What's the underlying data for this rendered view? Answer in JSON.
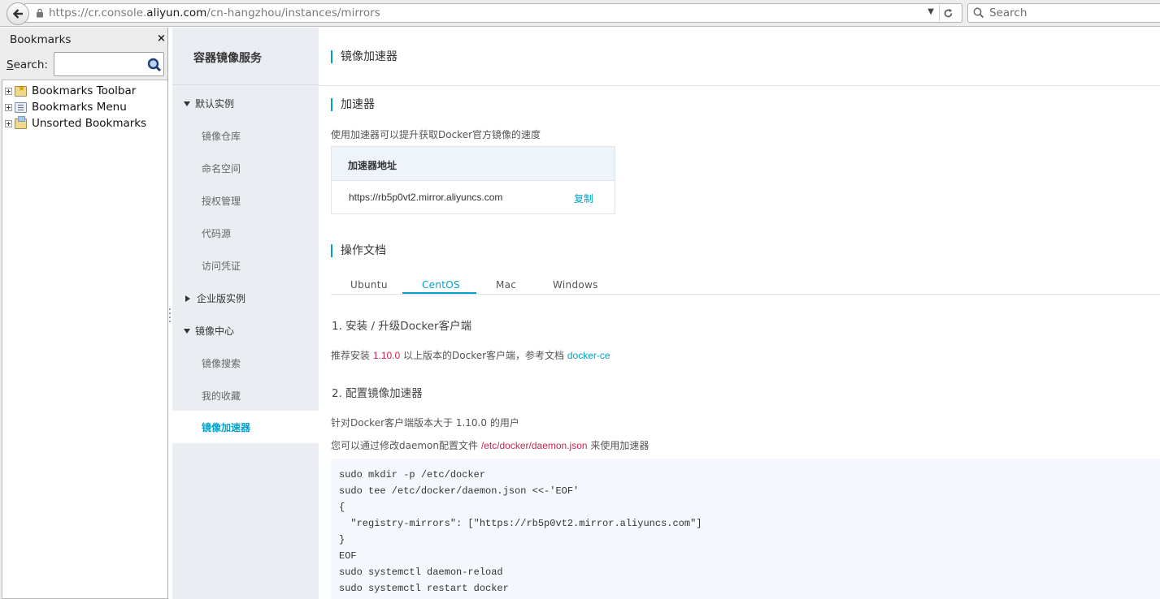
{
  "browser": {
    "url_host_prefix": "https://cr.console.",
    "url_domain": "aliyun.com",
    "url_path": "/cn-hangzhou/instances/mirrors",
    "search_placeholder": "Search"
  },
  "bookmarks": {
    "title": "Bookmarks",
    "close": "×",
    "search_label_key": "S",
    "search_label_rest": "earch:",
    "items": [
      {
        "label": "Bookmarks Toolbar"
      },
      {
        "label": "Bookmarks Menu"
      },
      {
        "label": "Unsorted Bookmarks"
      }
    ]
  },
  "nav": {
    "title": "容器镜像服务",
    "group_default": "默认实例",
    "default_items": [
      "镜像仓库",
      "命名空间",
      "授权管理",
      "代码源",
      "访问凭证"
    ],
    "group_enterprise": "企业版实例",
    "group_center": "镜像中心",
    "center_items": [
      "镜像搜索",
      "我的收藏"
    ],
    "active_item": "镜像加速器"
  },
  "main": {
    "page_title": "镜像加速器",
    "accelerator_title": "加速器",
    "accelerator_desc": "使用加速器可以提升获取Docker官方镜像的速度",
    "table_header": "加速器地址",
    "accelerator_url": "https://rb5p0vt2.mirror.aliyuncs.com",
    "copy_label": "复制",
    "docs_title": "操作文档",
    "tabs": [
      "Ubuntu",
      "CentOS",
      "Mac",
      "Windows"
    ],
    "active_tab": "CentOS",
    "step1_title": "1. 安装 / 升级Docker客户端",
    "step1_pre": "推荐安装 ",
    "step1_version": "1.10.0",
    "step1_mid": " 以上版本的Docker客户端，参考文档 ",
    "step1_link": "docker-ce",
    "step2_title": "2. 配置镜像加速器",
    "step2_desc1": "针对Docker客户端版本大于 1.10.0 的用户",
    "step2_desc2_pre": "您可以通过修改daemon配置文件 ",
    "step2_path": "/etc/docker/daemon.json",
    "step2_desc2_post": " 来使用加速器",
    "code_lines": [
      "sudo mkdir -p /etc/docker",
      "sudo tee /etc/docker/daemon.json <<-'EOF'",
      "{",
      "  \"registry-mirrors\": [\"https://rb5p0vt2.mirror.aliyuncs.com\"]",
      "}",
      "EOF",
      "sudo systemctl daemon-reload",
      "sudo systemctl restart docker"
    ]
  },
  "colors": {
    "accent": "#00a2ca",
    "highlight": "#c7254e",
    "nav_bg": "#eaedf1"
  }
}
